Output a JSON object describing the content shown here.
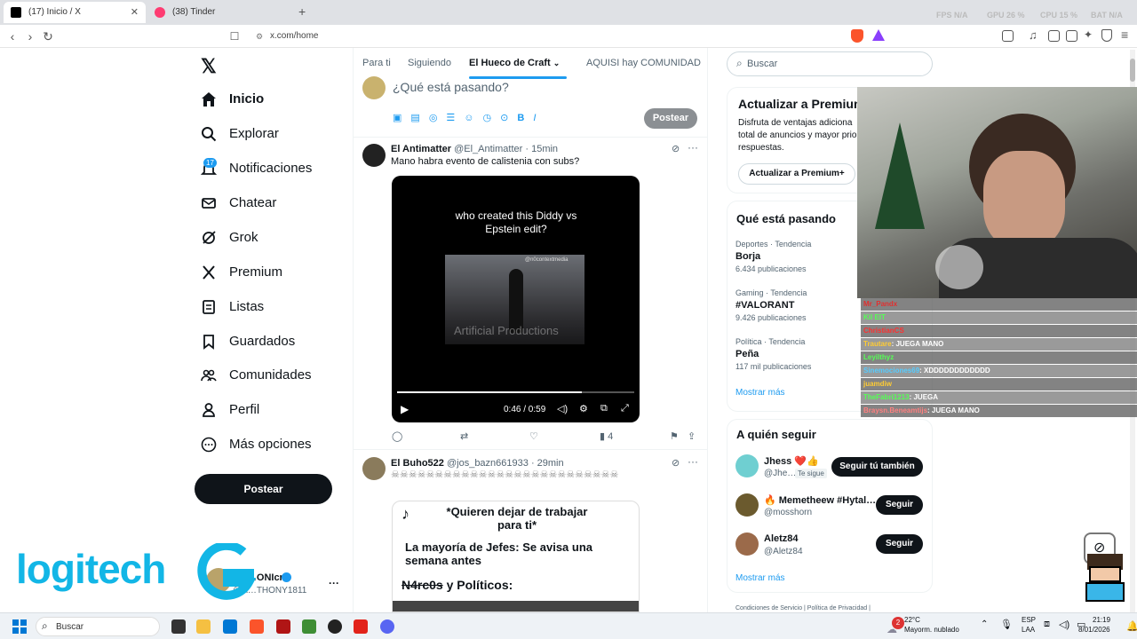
{
  "browser": {
    "tabs": [
      {
        "title": "(17) Inicio / X",
        "active": true
      },
      {
        "title": "(38) Tinder",
        "active": false
      }
    ],
    "url": "x.com/home",
    "stats": {
      "fps": "FPS  N/A",
      "gpu": "GPU  26 %",
      "cpu": "CPU  15 %",
      "bat": "BAT  N/A"
    }
  },
  "sidebar": {
    "items": [
      {
        "label": "Inicio",
        "icon": "home-icon"
      },
      {
        "label": "Explorar",
        "icon": "search-icon"
      },
      {
        "label": "Notificaciones",
        "icon": "bell-icon",
        "badge": "17"
      },
      {
        "label": "Chatear",
        "icon": "mail-icon"
      },
      {
        "label": "Grok",
        "icon": "grok-icon"
      },
      {
        "label": "Premium",
        "icon": "x-logo-icon"
      },
      {
        "label": "Listas",
        "icon": "list-icon"
      },
      {
        "label": "Guardados",
        "icon": "bookmark-icon"
      },
      {
        "label": "Comunidades",
        "icon": "people-icon"
      },
      {
        "label": "Perfil",
        "icon": "person-icon"
      },
      {
        "label": "Más opciones",
        "icon": "more-circle-icon"
      }
    ],
    "post_label": "Postear",
    "account_name": "AN…ONIcra",
    "account_handle": "@A…THONY1811"
  },
  "center": {
    "tabs": [
      "Para ti",
      "Siguiendo",
      "El Hueco de Craft",
      "AQUISI hay COMUNIDAD"
    ],
    "compose_placeholder": "¿Qué está pasando?",
    "compose_post": "Postear",
    "tweets": [
      {
        "name": "El Antimatter",
        "handle": "@El_Antimatter",
        "time": "· 15min",
        "text": "Mano habra evento de calistenia con subs?",
        "video_caption": "who created this Diddy vs Epstein edit?",
        "video_watermark": "@n0contextmedia",
        "video_overlay": "Artificial Productions",
        "video_time": "0:46 / 0:59",
        "video_progress": 0.78,
        "views": "4"
      },
      {
        "name": "El Buho522",
        "handle": "@jos_bazn661933",
        "time": "· 29min",
        "text": "☠☠☠☠☠☠☠☠☠☠☠☠☠☠☠☠☠☠☠☠☠☠☠☠☠☠",
        "card_title": "*Quieren dejar de trabajar para ti*",
        "card_line1": "La mayoría de Jefes: Se avisa una semana antes",
        "card_line2a": "N4rc0s",
        "card_line2b": " y Políticos:"
      }
    ]
  },
  "right": {
    "search_placeholder": "Buscar",
    "premium": {
      "title": "Actualizar a Premium",
      "text": "Disfruta de ventajas adiciona total de anuncios y mayor prio respuestas.",
      "button": "Actualizar a Premium+"
    },
    "trends_title": "Qué está pasando",
    "trends": [
      {
        "category": "Deportes · Tendencia",
        "name": "Borja",
        "count": "6.434 publicaciones"
      },
      {
        "category": "Gaming · Tendencia",
        "name": "#VALORANT",
        "count": "9.426 publicaciones"
      },
      {
        "category": "Política · Tendencia",
        "name": "Peña",
        "count": "117 mil publicaciones"
      }
    ],
    "show_more": "Mostrar más",
    "follow_title": "A quién seguir",
    "follow": [
      {
        "name": "Jhess ❤️👍",
        "handle": "@Jhe…",
        "badge": "Te sigue",
        "button": "Seguir tú también"
      },
      {
        "name": "🔥 Memetheew #Hytal…",
        "handle": "@mosshorn",
        "button": "Seguir"
      },
      {
        "name": "Aletz84",
        "handle": "@Aletz84",
        "button": "Seguir"
      }
    ],
    "show_more_2": "Mostrar más",
    "footer": "Condiciones de Servicio  |  Política de Privacidad  |"
  },
  "overlay": {
    "logo_text": "logitech",
    "chat": [
      {
        "user": "Mr_Pandx",
        "msg": "",
        "color": "#e03030"
      },
      {
        "user": "Kil EIT",
        "msg": "",
        "color": "#55ff55"
      },
      {
        "user": "ChristianCS",
        "msg": "",
        "color": "#ff3030"
      },
      {
        "user": "Trautare",
        "msg": ": JUEGA MANO",
        "color": "#ffcc33"
      },
      {
        "user": "Leyilthyz",
        "msg": "",
        "color": "#55ff55"
      },
      {
        "user": "Sinemociones69",
        "msg": ": XDDDDDDDDDDDD",
        "color": "#55ccff"
      },
      {
        "user": "juamdiw",
        "msg": "",
        "color": "#ffcc33"
      },
      {
        "user": "TheFabri1213",
        "msg": ": JUEGA",
        "color": "#55ff55"
      },
      {
        "user": "Braysn.Beneamtijs",
        "msg": ": JUEGA MANO",
        "color": "#ff8080"
      }
    ]
  },
  "taskbar": {
    "search": "Buscar",
    "weather_temp": "22°C",
    "weather_desc": "Mayorm. nublado",
    "lang1": "ESP",
    "lang2": "LAA",
    "time": "21:19",
    "date": "8/01/2026",
    "notif_badge": "2"
  }
}
